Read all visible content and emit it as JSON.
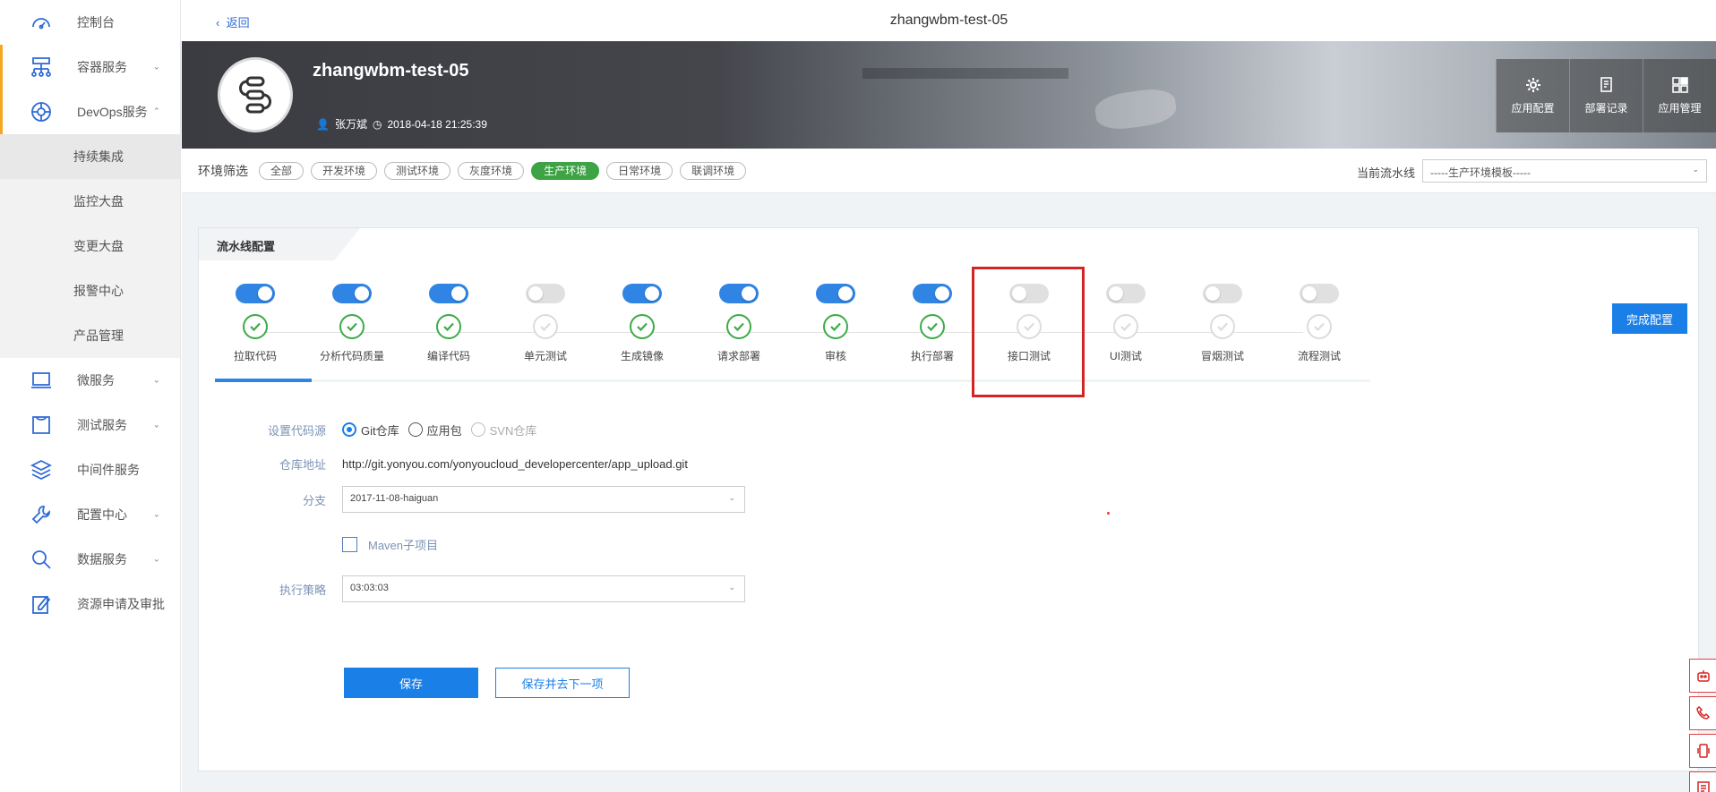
{
  "sidebar": {
    "items": [
      {
        "label": "控制台",
        "icon": "dashboard-icon"
      },
      {
        "label": "容器服务",
        "icon": "container-icon"
      },
      {
        "label": "DevOps服务",
        "icon": "devops-icon"
      },
      {
        "label": "微服务",
        "icon": "monitor-icon"
      },
      {
        "label": "测试服务",
        "icon": "test-icon"
      },
      {
        "label": "中间件服务",
        "icon": "layers-icon"
      },
      {
        "label": "配置中心",
        "icon": "wrench-icon"
      },
      {
        "label": "数据服务",
        "icon": "search-icon"
      },
      {
        "label": "资源申请及审批",
        "icon": "edit-icon"
      }
    ],
    "sub_items": [
      "持续集成",
      "监控大盘",
      "变更大盘",
      "报警中心",
      "产品管理"
    ]
  },
  "topbar": {
    "back_label": "返回",
    "title": "zhangwbm-test-05"
  },
  "hero": {
    "app_name": "zhangwbm-test-05",
    "user": "张万斌",
    "timestamp": "2018-04-18 21:25:39",
    "buttons": [
      "应用配置",
      "部署记录",
      "应用管理"
    ]
  },
  "filter": {
    "label": "环境筛选",
    "chips": [
      "全部",
      "开发环境",
      "测试环境",
      "灰度环境",
      "生产环境",
      "日常环境",
      "联调环境"
    ],
    "selected": "生产环境",
    "pipeline_label": "当前流水线",
    "pipeline_value": "-----生产环境模板-----"
  },
  "card": {
    "title": "流水线配置",
    "done_button": "完成配置",
    "steps": [
      {
        "label": "拉取代码",
        "enabled": true
      },
      {
        "label": "分析代码质量",
        "enabled": true
      },
      {
        "label": "编译代码",
        "enabled": true
      },
      {
        "label": "单元测试",
        "enabled": false
      },
      {
        "label": "生成镜像",
        "enabled": true
      },
      {
        "label": "请求部署",
        "enabled": true
      },
      {
        "label": "审核",
        "enabled": true
      },
      {
        "label": "执行部署",
        "enabled": true
      },
      {
        "label": "接口测试",
        "enabled": false
      },
      {
        "label": "UI测试",
        "enabled": false
      },
      {
        "label": "冒烟测试",
        "enabled": false
      },
      {
        "label": "流程测试",
        "enabled": false
      }
    ]
  },
  "form": {
    "source_label": "设置代码源",
    "source_options": [
      "Git仓库",
      "应用包",
      "SVN仓库"
    ],
    "source_selected": "Git仓库",
    "repo_label": "仓库地址",
    "repo_value": "http://git.yonyou.com/yonyoucloud_developercenter/app_upload.git",
    "branch_label": "分支",
    "branch_value": "2017-11-08-haiguan",
    "maven_label": "Maven子项目",
    "strategy_label": "执行策略",
    "strategy_value": "03:03:03",
    "save_label": "保存",
    "save_next_label": "保存并去下一项"
  },
  "colors": {
    "accent": "#1b7fe8",
    "success": "#3cab47",
    "highlight": "#d42424",
    "nav_bar": "#f5a623"
  }
}
